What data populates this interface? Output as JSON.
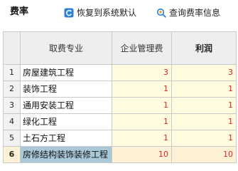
{
  "panel": {
    "title": "费率"
  },
  "toolbar": {
    "restore_label": "恢复到系统默认",
    "restore_icon": "restore-icon",
    "query_label": "查询费率信息",
    "query_icon": "search-icon"
  },
  "table": {
    "headers": {
      "row_number": "",
      "profession": "取费专业",
      "management_fee": "企业管理费",
      "profit": "利润"
    },
    "rows": [
      {
        "no": "1",
        "name": "房屋建筑工程",
        "management_fee": "3",
        "profit": "3"
      },
      {
        "no": "2",
        "name": "装饰工程",
        "management_fee": "1",
        "profit": "1"
      },
      {
        "no": "3",
        "name": "通用安装工程",
        "management_fee": "1",
        "profit": "1"
      },
      {
        "no": "4",
        "name": "绿化工程",
        "management_fee": "1",
        "profit": "1"
      },
      {
        "no": "5",
        "name": "土石方工程",
        "management_fee": "1",
        "profit": "1"
      },
      {
        "no": "6",
        "name": "房修结构装饰装修工程",
        "management_fee": "10",
        "profit": "10"
      }
    ],
    "selected_row": 6
  },
  "colors": {
    "accent_blue": "#2f80d1",
    "value_red": "#e02424",
    "editable_cell_bg": "#fffbdf",
    "selected_cell_bg": "#a9c9d9"
  }
}
